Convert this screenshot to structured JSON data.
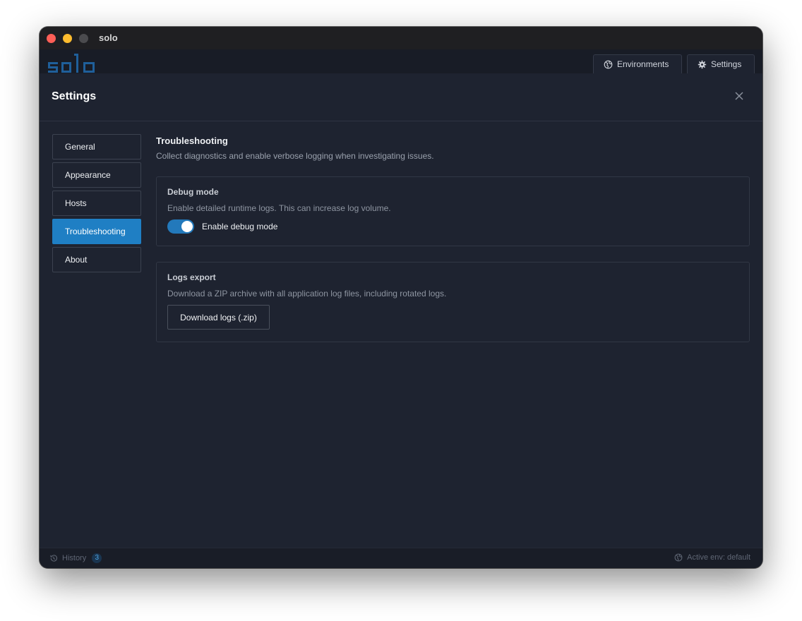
{
  "window": {
    "title": "solo"
  },
  "header": {
    "logo_text": "solo",
    "environments_label": "Environments",
    "settings_label": "Settings"
  },
  "panel": {
    "title": "Settings"
  },
  "nav": {
    "items": [
      {
        "label": "General",
        "active": false
      },
      {
        "label": "Appearance",
        "active": false
      },
      {
        "label": "Hosts",
        "active": false
      },
      {
        "label": "Troubleshooting",
        "active": true
      },
      {
        "label": "About",
        "active": false
      }
    ]
  },
  "section": {
    "title": "Troubleshooting",
    "description": "Collect diagnostics and enable verbose logging when investigating issues."
  },
  "debug": {
    "title": "Debug mode",
    "description": "Enable detailed runtime logs. This can increase log volume.",
    "toggle_label": "Enable debug mode",
    "enabled": true
  },
  "logs": {
    "title": "Logs export",
    "description": "Download a ZIP archive with all application log files, including rotated logs.",
    "button_label": "Download logs (.zip)"
  },
  "status": {
    "history_label": "History",
    "history_count": "3",
    "active_env": "Active env: default"
  },
  "colors": {
    "accent": "#1f7fc4",
    "background": "#1e2330",
    "logo": "#1f5f9a"
  },
  "icons": {
    "environments": "globe-icon",
    "settings": "gear-icon",
    "close": "close-icon",
    "history": "history-icon",
    "active_env": "globe-icon"
  }
}
